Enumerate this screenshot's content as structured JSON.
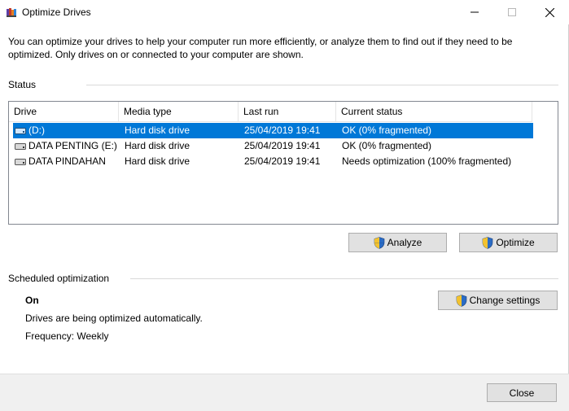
{
  "window": {
    "title": "Optimize Drives"
  },
  "description": "You can optimize your drives to help your computer run more efficiently, or analyze them to find out if they need to be optimized. Only drives on or connected to your computer are shown.",
  "status": {
    "label": "Status",
    "columns": [
      "Drive",
      "Media type",
      "Last run",
      "Current status"
    ],
    "drives": [
      {
        "drive": "(D:)",
        "media_type": "Hard disk drive",
        "last_run": "25/04/2019 19:41",
        "current_status": "OK (0% fragmented)",
        "selected": true
      },
      {
        "drive": "DATA PENTING (E:)",
        "media_type": "Hard disk drive",
        "last_run": "25/04/2019 19:41",
        "current_status": "OK (0% fragmented)",
        "selected": false
      },
      {
        "drive": "DATA PINDAHAN",
        "media_type": "Hard disk drive",
        "last_run": "25/04/2019 19:41",
        "current_status": "Needs optimization (100% fragmented)",
        "selected": false
      }
    ],
    "analyze_label": "Analyze",
    "optimize_label": "Optimize"
  },
  "scheduled": {
    "label": "Scheduled optimization",
    "state": "On",
    "description": "Drives are being optimized automatically.",
    "frequency": "Frequency: Weekly",
    "change_settings_label": "Change settings"
  },
  "footer": {
    "close_label": "Close"
  },
  "colors": {
    "selection": "#0078d7",
    "button_face": "#e1e1e1",
    "footer_bg": "#f0f0f0"
  },
  "icons": {
    "app": "defrag-app-icon",
    "drive": "hard-drive-icon",
    "button": "uac-shield-icon"
  }
}
